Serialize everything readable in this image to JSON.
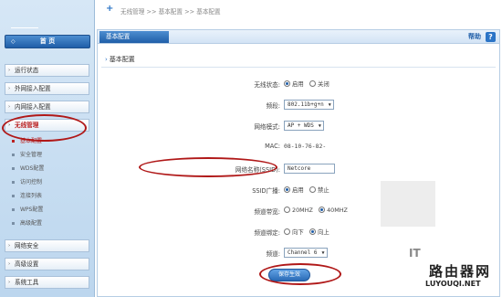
{
  "breadcrumb": "无线管理 >> 基本配置 >> 基本配置",
  "sidebar": {
    "home": "首 页",
    "items": [
      {
        "label": "运行状态",
        "active": false
      },
      {
        "label": "外网接入配置",
        "active": false
      },
      {
        "label": "内网接入配置",
        "active": false
      },
      {
        "label": "无线管理",
        "active": true
      }
    ],
    "subitems": [
      {
        "label": "基本配置",
        "current": true
      },
      {
        "label": "安全管理",
        "current": false
      },
      {
        "label": "WDS配置",
        "current": false
      },
      {
        "label": "访问控制",
        "current": false
      },
      {
        "label": "连接列表",
        "current": false
      },
      {
        "label": "WPS配置",
        "current": false
      },
      {
        "label": "高级配置",
        "current": false
      }
    ],
    "bottom_items": [
      {
        "label": "网络安全"
      },
      {
        "label": "高级设置"
      },
      {
        "label": "系统工具"
      }
    ]
  },
  "panel": {
    "tab": "基本配置",
    "help": "帮助",
    "help_icon": "?",
    "section_title": "基本配置"
  },
  "form": {
    "wireless_status": {
      "label": "无线状态:",
      "options": [
        "启用",
        "关闭"
      ],
      "selected": "启用"
    },
    "band": {
      "label": "频段:",
      "value": "802.11b+g+n"
    },
    "network_mode": {
      "label": "网络模式:",
      "value": "AP + WDS"
    },
    "mac": {
      "label": "MAC:",
      "value": "08-10-76-82-"
    },
    "ssid": {
      "label": "网络名称(SSID):",
      "value": "Netcore"
    },
    "ssid_broadcast": {
      "label": "SSID广播:",
      "options": [
        "启用",
        "禁止"
      ],
      "selected": "启用"
    },
    "bandwidth": {
      "label": "频道带宽:",
      "options": [
        "20MHZ",
        "40MHZ"
      ],
      "selected": "40MHZ"
    },
    "channel_bind": {
      "label": "频道绑定:",
      "options": [
        "向下",
        "向上"
      ],
      "selected": "向上"
    },
    "channel": {
      "label": "频道:",
      "value": "Channel 6"
    }
  },
  "save_button": "保存生效",
  "watermark": {
    "it": "IT",
    "cn": "路由器网",
    "url": "LUYOUQI.NET"
  },
  "colors": {
    "accent": "#1f5ea8",
    "annotation": "#b01818",
    "active_text": "#b22222"
  }
}
